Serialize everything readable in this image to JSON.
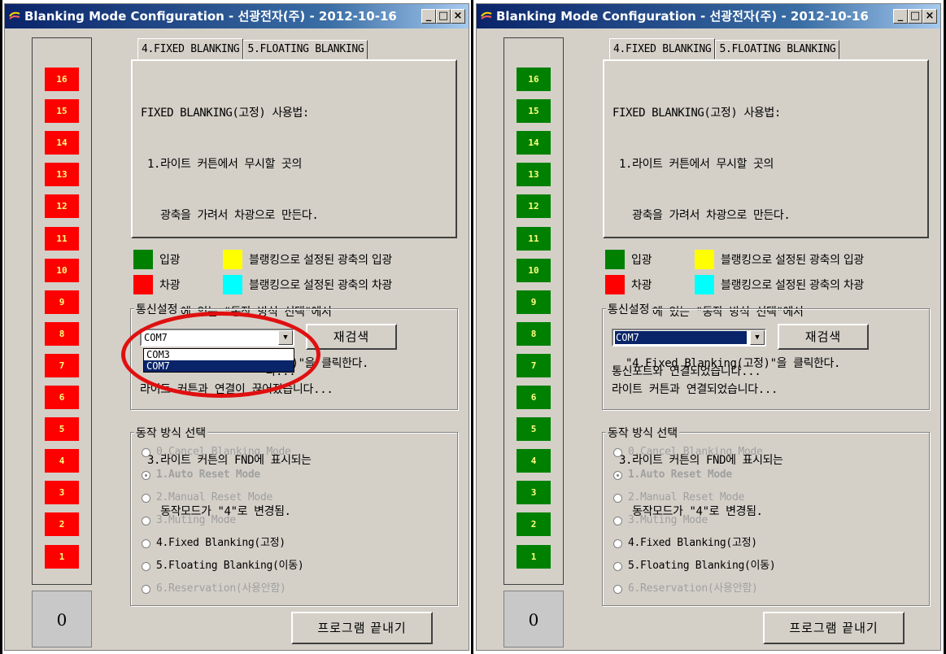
{
  "colors": {
    "led_red": "#ff0000",
    "led_green": "#008000",
    "legend_green": "#008000",
    "legend_red": "#ff0000",
    "legend_yellow": "#ffff00",
    "legend_cyan": "#00ffff",
    "highlight_oval": "#e01010"
  },
  "windows": [
    {
      "title": "Blanking Mode Configuration - 선광전자(주) - 2012-10-16",
      "title_icon": "app-icon",
      "tabs": [
        {
          "label": "4.FIXED BLANKING"
        },
        {
          "label": "5.FLOATING BLANKING"
        }
      ],
      "leds": {
        "state_color": "red",
        "labels": [
          "16",
          "15",
          "14",
          "13",
          "12",
          "11",
          "10",
          "9",
          "8",
          "7",
          "6",
          "5",
          "4",
          "3",
          "2",
          "1"
        ]
      },
      "counter": "0",
      "info_lines": [
        "FIXED BLANKING(고정) 사용법:",
        " 1.라이트 커튼에서 무시할 곳의",
        "   광축을 가려서 차광으로 만든다.",
        "",
        " 2.아래에 있는 \"동작 방식 선택\"에서",
        "  \"4.Fixed Blanking(고정)\"을 클릭한다.",
        "",
        " 3.라이트 커튼의 FND에 표시되는",
        "   동작모드가 \"4\"로 변경됨."
      ],
      "legend": {
        "light_in": "입광",
        "blocked": "차광",
        "blank_in": "블랭킹으로 설정된 광축의 입광",
        "blank_blocked": "블랭킹으로 설정된 광축의 차광"
      },
      "comm": {
        "title": "통신설정",
        "port_value": "COM7",
        "rescan_label": "재검색",
        "dropdown_open": true,
        "dropdown_options": [
          "COM3",
          "COM7"
        ],
        "status_line1": "통신포트와 연결되었습니다...",
        "status_line1_visible": "                   다...",
        "status_line2": "라이트 커튼과 연결이 끊어졌습니다..."
      },
      "mode": {
        "title": "동작 방식 선택",
        "options": [
          {
            "label": "0.Cancel Blanking Mode"
          },
          {
            "label": "1.Auto Reset Mode"
          },
          {
            "label": "2.Manual Reset Mode"
          },
          {
            "label": "3.Muting Mode"
          },
          {
            "label": "4.Fixed Blanking(고정)"
          },
          {
            "label": "5.Floating Blanking(이동)"
          },
          {
            "label": "6.Reservation(사용안함)"
          }
        ]
      },
      "exit_label": "프로그램 끝내기"
    },
    {
      "title": "Blanking Mode Configuration - 선광전자(주) - 2012-10-16",
      "title_icon": "app-icon",
      "tabs": [
        {
          "label": "4.FIXED BLANKING"
        },
        {
          "label": "5.FLOATING BLANKING"
        }
      ],
      "leds": {
        "state_color": "green",
        "labels": [
          "16",
          "15",
          "14",
          "13",
          "12",
          "11",
          "10",
          "9",
          "8",
          "7",
          "6",
          "5",
          "4",
          "3",
          "2",
          "1"
        ]
      },
      "counter": "0",
      "info_lines": [
        "FIXED BLANKING(고정) 사용법:",
        " 1.라이트 커튼에서 무시할 곳의",
        "   광축을 가려서 차광으로 만든다.",
        "",
        " 2.아래에 있는 \"동작 방식 선택\"에서",
        "  \"4.Fixed Blanking(고정)\"을 클릭한다.",
        "",
        " 3.라이트 커튼의 FND에 표시되는",
        "   동작모드가 \"4\"로 변경됨."
      ],
      "legend": {
        "light_in": "입광",
        "blocked": "차광",
        "blank_in": "블랭킹으로 설정된 광축의 입광",
        "blank_blocked": "블랭킹으로 설정된 광축의 차광"
      },
      "comm": {
        "title": "통신설정",
        "port_value": "COM7",
        "rescan_label": "재검색",
        "dropdown_open": false,
        "dropdown_options": [],
        "status_line1": "통신포트와 연결되었습니다...",
        "status_line2": "라이트 커튼과 연결되었습니다..."
      },
      "mode": {
        "title": "동작 방식 선택",
        "options": [
          {
            "label": "0.Cancel Blanking Mode"
          },
          {
            "label": "1.Auto Reset Mode"
          },
          {
            "label": "2.Manual Reset Mode"
          },
          {
            "label": "3.Muting Mode"
          },
          {
            "label": "4.Fixed Blanking(고정)"
          },
          {
            "label": "5.Floating Blanking(이동)"
          },
          {
            "label": "6.Reservation(사용안함)"
          }
        ]
      },
      "exit_label": "프로그램 끝내기"
    }
  ]
}
